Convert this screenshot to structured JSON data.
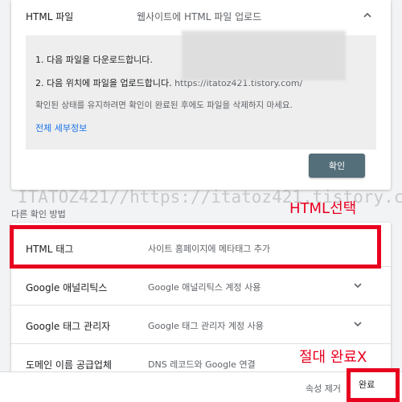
{
  "methods": {
    "html_file": {
      "title": "HTML 파일",
      "description": "웹사이트에 HTML 파일 업로드",
      "step1": "1. 다음 파일을 다운로드합니다.",
      "step2_text": "2. 다음 위치에 파일을 업로드합니다.",
      "step2_url": "https://itatoz421.tistory.com/",
      "note": "확인된 상태를 유지하려면 확인이 완료된 후에도 파일을 삭제하지 마세요.",
      "more_details": "전체 세부정보",
      "confirm_label": "확인"
    }
  },
  "watermark": "ITATOZ421//https://itatoz421.tistory.com",
  "other_methods_heading": "다른 확인 방법",
  "other_methods": [
    {
      "title": "HTML 태그",
      "description": "사이트 홈페이지에 메타태그 추가"
    },
    {
      "title": "Google 애널리틱스",
      "description": "Google 애널리틱스 계정 사용"
    },
    {
      "title": "Google 태그 관리자",
      "description": "Google 태그 관리자 계정 사용"
    },
    {
      "title": "도메인 이름 공급업체",
      "description": "DNS 레코드와 Google 연결"
    }
  ],
  "annotations": {
    "html_select": "HTML선택",
    "no_done": "절대 완료X"
  },
  "footer": {
    "remove_property": "속성 제거",
    "done_label": "완료"
  },
  "colors": {
    "accent_red": "#e8001f",
    "confirm_button": "#546e7a",
    "link_blue": "#1a73e8"
  }
}
